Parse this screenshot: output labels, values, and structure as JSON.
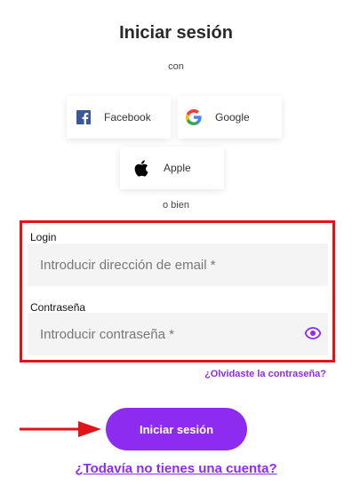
{
  "title": "Iniciar sesión",
  "social_intro": "con",
  "social": {
    "facebook": {
      "label": "Facebook",
      "icon": "facebook-icon",
      "color": "#3b5998"
    },
    "google": {
      "label": "Google",
      "icon": "google-icon"
    },
    "apple": {
      "label": "Apple",
      "icon": "apple-icon"
    }
  },
  "separator": "o bien",
  "form": {
    "login_label": "Login",
    "email_placeholder": "Introducir dirección de email *",
    "email_value": "",
    "password_label": "Contraseña",
    "password_placeholder": "Introducir contraseña *",
    "password_value": "",
    "toggle_icon": "eye-icon",
    "highlight_color": "#e0131b"
  },
  "forgot_link": "¿Olvidaste la contraseña?",
  "submit_label": "Iniciar sesión",
  "signup_link": "¿Todavía no tienes una cuenta?",
  "colors": {
    "accent": "#8d2cf0",
    "annotation": "#e0131b"
  }
}
